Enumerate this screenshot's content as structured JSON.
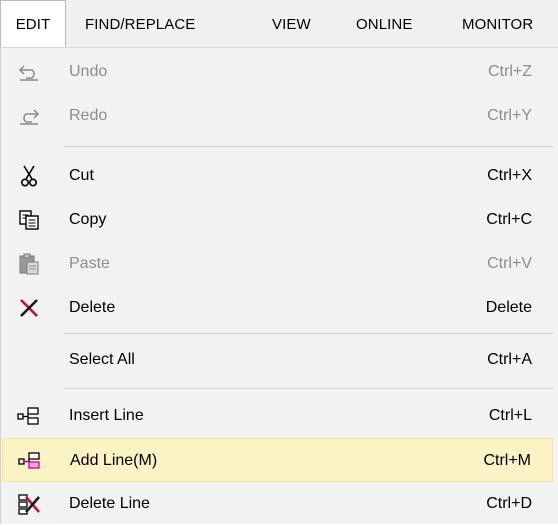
{
  "menubar": {
    "items": [
      {
        "label": "EDIT",
        "active": true
      },
      {
        "label": "FIND/REPLACE",
        "active": false
      },
      {
        "label": "VIEW",
        "active": false
      },
      {
        "label": "ONLINE",
        "active": false
      },
      {
        "label": "MONITOR",
        "active": false
      }
    ]
  },
  "edit_menu": {
    "items": [
      {
        "label": "Undo",
        "shortcut": "Ctrl+Z",
        "icon": "undo-icon",
        "enabled": false
      },
      {
        "label": "Redo",
        "shortcut": "Ctrl+Y",
        "icon": "redo-icon",
        "enabled": false
      },
      {
        "label": "Cut",
        "shortcut": "Ctrl+X",
        "icon": "scissors-icon",
        "enabled": true
      },
      {
        "label": "Copy",
        "shortcut": "Ctrl+C",
        "icon": "copy-icon",
        "enabled": true
      },
      {
        "label": "Paste",
        "shortcut": "Ctrl+V",
        "icon": "paste-icon",
        "enabled": false
      },
      {
        "label": "Delete",
        "shortcut": "Delete",
        "icon": "delete-x-icon",
        "enabled": true
      },
      {
        "label": "Select All",
        "shortcut": "Ctrl+A",
        "icon": "",
        "enabled": true
      },
      {
        "label": "Insert Line",
        "shortcut": "Ctrl+L",
        "icon": "insert-line-icon",
        "enabled": true
      },
      {
        "label": "Add Line(M)",
        "shortcut": "Ctrl+M",
        "icon": "add-line-icon",
        "enabled": true,
        "highlighted": true
      },
      {
        "label": "Delete Line",
        "shortcut": "Ctrl+D",
        "icon": "delete-line-icon",
        "enabled": true
      }
    ]
  },
  "colors": {
    "menubar_bg": "#f0f0f0",
    "dropdown_bg": "#f2f2f2",
    "highlight_bg": "#fcf3c4",
    "disabled_text": "#8d8d8d",
    "delete_red": "#c8102e"
  }
}
